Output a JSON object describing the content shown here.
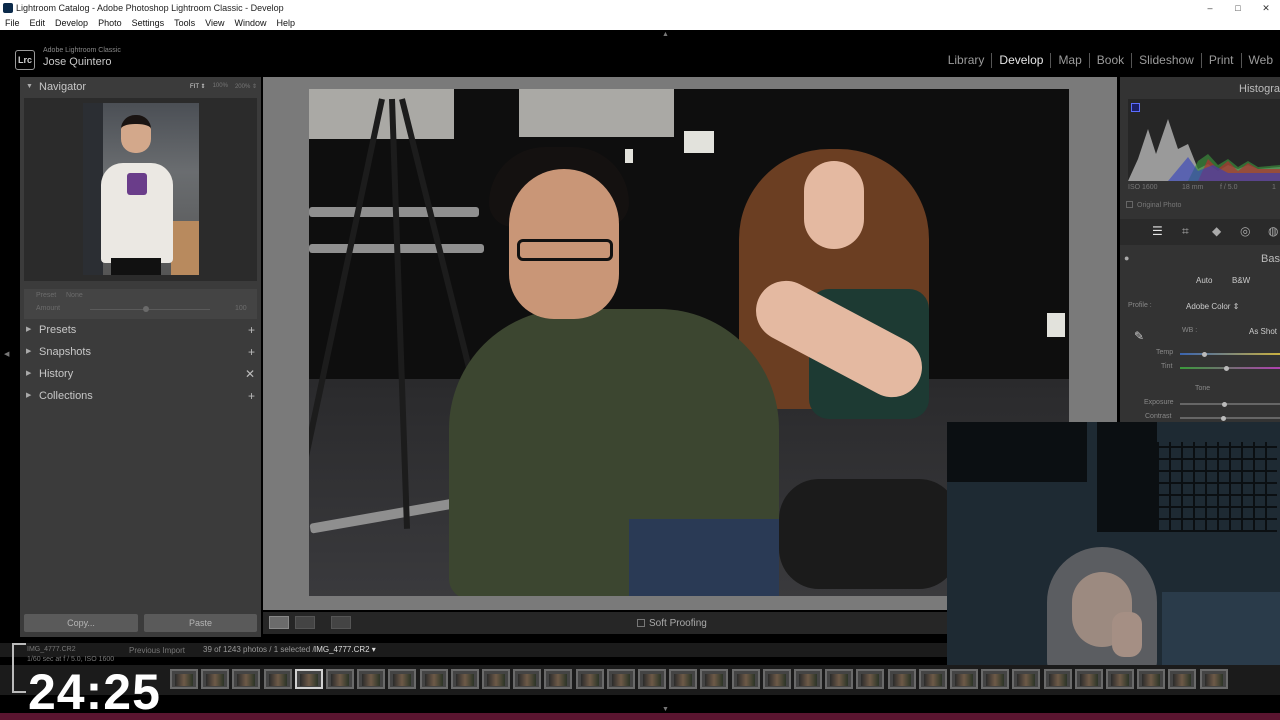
{
  "window": {
    "title": "Lightroom Catalog - Adobe Photoshop Lightroom Classic - Develop",
    "controls": [
      "–",
      "□",
      "✕"
    ]
  },
  "menubar": [
    "File",
    "Edit",
    "Develop",
    "Photo",
    "Settings",
    "Tools",
    "View",
    "Window",
    "Help"
  ],
  "identity": {
    "logo": "Lrc",
    "product": "Adobe Lightroom Classic",
    "user": "Jose Quintero"
  },
  "modules": [
    "Library",
    "Develop",
    "Map",
    "Book",
    "Slideshow",
    "Print",
    "Web"
  ],
  "active_module": "Develop",
  "left_panel": {
    "navigator": {
      "title": "Navigator",
      "zoom_options": [
        "FIT ⇕",
        "100%",
        "200% ⇕"
      ]
    },
    "quick": {
      "preset_label": "Preset",
      "preset_value": "None",
      "amount_label": "Amount",
      "amount_value": "100"
    },
    "sections": [
      {
        "label": "Presets",
        "action": "+"
      },
      {
        "label": "Snapshots",
        "action": "+"
      },
      {
        "label": "History",
        "action": "✕"
      },
      {
        "label": "Collections",
        "action": "+"
      }
    ],
    "copy_label": "Copy...",
    "paste_label": "Paste"
  },
  "toolbar": {
    "soft_proofing": "Soft Proofing"
  },
  "right_panel": {
    "histogram_title": "Histogra",
    "meta": [
      "ISO 1600",
      "18 mm",
      "f / 5.0",
      "1"
    ],
    "original_photo": "Original Photo",
    "basic_title": "Bas",
    "auto": "Auto",
    "bw": "B&W",
    "profile_label": "Profile :",
    "profile_value": "Adobe Color ⇕",
    "wb_label": "WB :",
    "wb_value": "As Shot",
    "temp": "Temp",
    "tint": "Tint",
    "tone": "Tone",
    "exposure": "Exposure",
    "contrast": "Contrast"
  },
  "status": {
    "file_overlay": "IMG_4777.CR2",
    "exposure_overlay": "1/60 sec at f / 5.0, ISO 1600",
    "prev_import": "Previous Import",
    "count": "39 of 1243 photos / 1 selected /",
    "filename": "IMG_4777.CR2 ▾"
  },
  "timer": "24:25",
  "colors": {
    "panel_bg": "#3b3b3b",
    "center_bg": "#7a7a7a",
    "accent_purple": "#5a1530",
    "hist_clip": "#5b6cff"
  }
}
